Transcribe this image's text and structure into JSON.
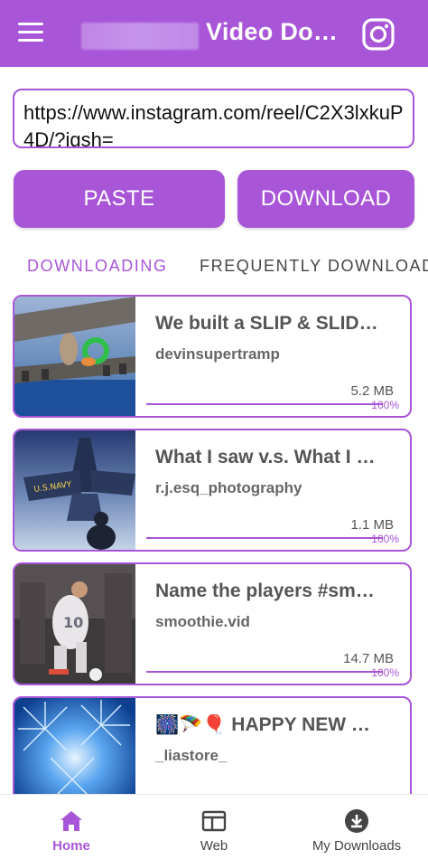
{
  "app_bar": {
    "title": "Video Do…",
    "menu_icon": "menu-icon",
    "instagram_icon": "instagram-icon",
    "background": "#a855d8"
  },
  "url_input": {
    "value": "https://www.instagram.com/reel/C2X3lxkuP4D/?igsh="
  },
  "buttons": {
    "paste_label": "PASTE",
    "download_label": "DOWNLOAD"
  },
  "tabs": [
    {
      "label": "DOWNLOADING",
      "active": true
    },
    {
      "label": "FREQUENTLY DOWNLOADED",
      "active": false
    }
  ],
  "downloads": [
    {
      "title": "We built a SLIP & SLID…",
      "user": "devinsupertramp",
      "size": "5.2 MB",
      "progress": "100%"
    },
    {
      "title": "What I saw v.s. What I …",
      "user": "r.j.esq_photography",
      "size": "1.1 MB",
      "progress": "100%"
    },
    {
      "title": "Name the players #sm…",
      "user": "smoothie.vid",
      "size": "14.7 MB",
      "progress": "100%"
    },
    {
      "title": "🎆🪂🎈 HAPPY NEW …",
      "user": "_liastore_",
      "size": "",
      "progress": ""
    }
  ],
  "bottom_nav": [
    {
      "label": "Home",
      "icon": "home-icon",
      "active": true
    },
    {
      "label": "Web",
      "icon": "web-icon",
      "active": false
    },
    {
      "label": "My Downloads",
      "icon": "download-icon",
      "active": false
    }
  ],
  "colors": {
    "accent": "#a855d8",
    "text_dark": "#555555"
  }
}
